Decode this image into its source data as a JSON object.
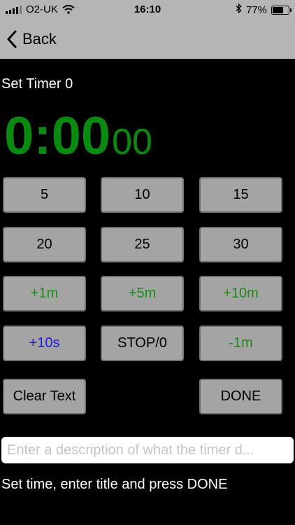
{
  "status_bar": {
    "carrier": "O2-UK",
    "time": "16:10",
    "battery_percent": "77%",
    "battery_level": 0.77,
    "icons": [
      "signal-icon",
      "wifi-icon",
      "bluetooth-icon",
      "battery-icon"
    ]
  },
  "nav": {
    "back_label": "Back"
  },
  "timer": {
    "title": "Set Timer 0",
    "main_display": "0:00",
    "seconds_display": "00",
    "color": "#0b8a12"
  },
  "buttons": {
    "b5": "5",
    "b10": "10",
    "b15": "15",
    "b20": "20",
    "b25": "25",
    "b30": "30",
    "plus1m": "+1m",
    "plus5m": "+5m",
    "plus10m": "+10m",
    "plus10s": "+10s",
    "stop": "STOP/0",
    "minus1m": "-1m",
    "clear_text": "Clear Text",
    "done": "DONE"
  },
  "description": {
    "value": "",
    "placeholder": "Enter a description of what the timer d..."
  },
  "hint": "Set time, enter title and press DONE",
  "colors": {
    "nav_bg": "#b5b5b5",
    "button_bg": "#a4a4a4",
    "green_text": "#1a8a1a",
    "blue_text": "#1a1aee"
  }
}
